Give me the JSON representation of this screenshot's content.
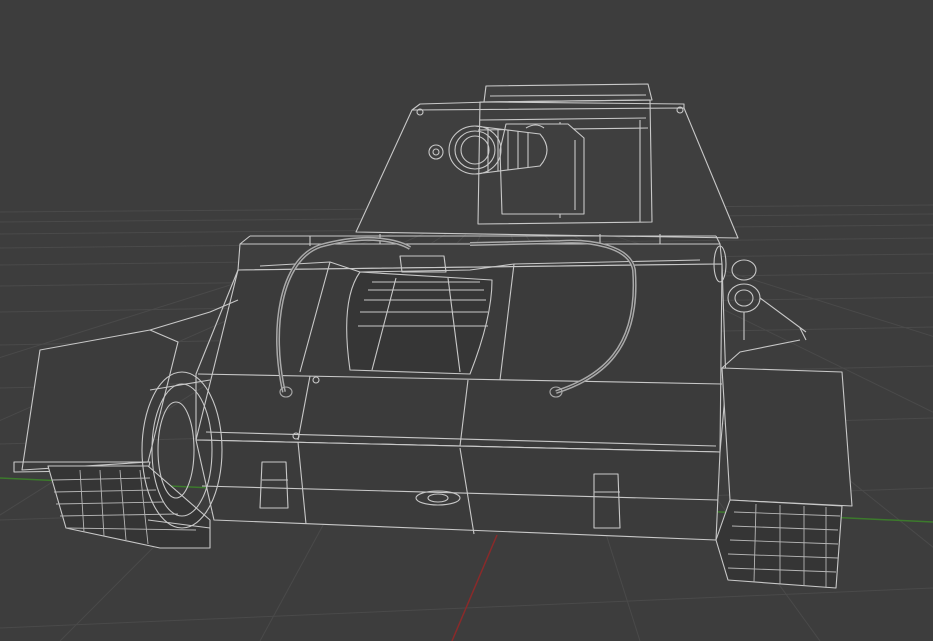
{
  "viewport": {
    "background": "#3d3d3d",
    "grid_color": "#4a4a4a",
    "x_axis_color": "#8a2a2a",
    "y_axis_color": "#3c7a2c",
    "wire_color": "#c8c8c8",
    "wire_dim_color": "#a9a9a9"
  },
  "model": {
    "display_mode": "wireframe"
  }
}
